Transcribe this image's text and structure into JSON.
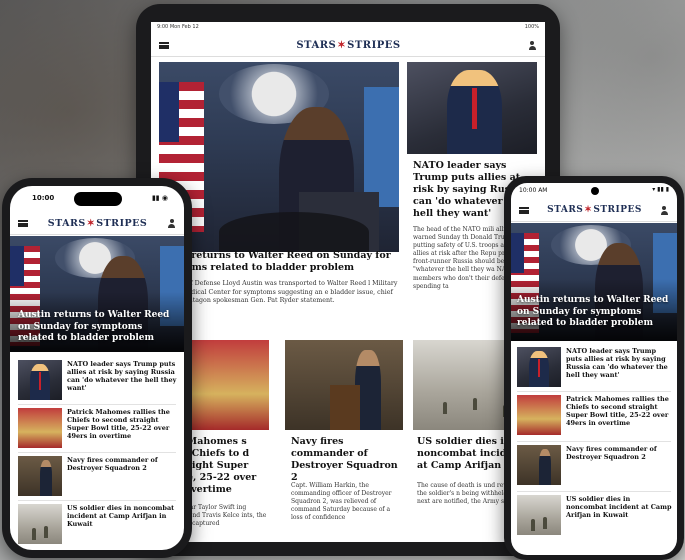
{
  "tablet": {
    "status_time": "9:00 Mon Feb 12",
    "status_right": "100%",
    "logo_left": "STARS",
    "logo_right": "STRIPES",
    "lead_headline": "Austin returns to Walter Reed on Sunday for symptoms related to bladder problem",
    "lead_headline_visible": "n returns to Walter Reed on Sunday for toms related to bladder problem",
    "lead_body": "y of Defense Lloyd Austin was transported to Walter Reed l Military Medical Center for symptoms suggesting an e bladder issue, chief Pentagon spokesman Gen. Pat Ryder statement.",
    "side_headline": "NATO leader says Trump puts allies at risk by saying Russia can 'do whatever the hell they want'",
    "side_body": "The head of the NATO mili alliance warned Sunday th Donald Trump was putting safety of U.S. troops and th allies at risk after the Repu presidential front-runner Russia should be able to d \"whatever the hell they wa NATO members who don't their defense spending ta",
    "cards": [
      {
        "headline": "ck Mahomes s the Chiefs to d straight Super title, 25-22 over in overtime",
        "body": "pop star Taylor Swift ing boyfriend Travis Kelce ints, the Chiefs captured"
      },
      {
        "headline": "Navy fires commander of Destroyer Squadron 2",
        "body": "Capt. William Harkin, the commanding officer of Destroyer Squadron 2, was relieved of command Saturday because of a loss of confidence"
      },
      {
        "headline": "US soldier dies in noncombat incident at Camp Arifjan in Ku",
        "body": "The cause of death is und review and the soldier's n being withheld until next are notified, the Army sai"
      }
    ]
  },
  "phone_left": {
    "status_time": "10:00",
    "logo_left": "STARS",
    "logo_right": "STRIPES",
    "hero_title": "Austin returns to Walter Reed on Sunday for symptoms related to bladder problem",
    "items": [
      "NATO leader says Trump puts allies at risk by saying Russia can 'do whatever the hell they want'",
      "Patrick Mahomes rallies the Chiefs to second straight Super Bowl title, 25-22 over 49ers in overtime",
      "Navy fires commander of Destroyer Squadron 2",
      "US soldier dies in noncombat incident at Camp Arifjan in Kuwait"
    ]
  },
  "phone_right": {
    "status_time": "10:00 AM",
    "logo_left": "STARS",
    "logo_right": "STRIPES",
    "hero_title": "Austin returns to Walter Reed on Sunday for symptoms related to bladder problem",
    "items": [
      "NATO leader says Trump puts allies at risk by saying Russia can 'do whatever the hell they want'",
      "Patrick Mahomes rallies the Chiefs to second straight Super Bowl title, 25-22 over 49ers in overtime",
      "Navy fires commander of Destroyer Squadron 2",
      "US soldier dies in noncombat incident at Camp Arifjan in Kuwait"
    ]
  },
  "colors": {
    "logo_blue": "#1f2f55",
    "logo_red": "#c1272d"
  }
}
